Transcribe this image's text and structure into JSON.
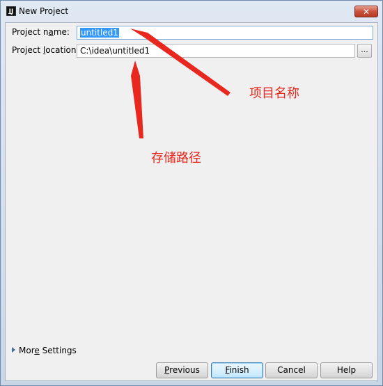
{
  "window": {
    "title": "New Project",
    "close_label": "✕"
  },
  "form": {
    "name_label": {
      "pre": "Project n",
      "accel": "a",
      "post": "me:"
    },
    "name_value": "untitled1",
    "location_label": {
      "pre": "Project ",
      "accel": "l",
      "post": "ocation:"
    },
    "location_value": "C:\\idea\\untitled1",
    "browse_label": "..."
  },
  "more_settings": {
    "pre": "Mor",
    "accel": "e",
    "post": " Settings"
  },
  "buttons": {
    "previous": {
      "accel": "P",
      "rest": "revious"
    },
    "finish": {
      "accel": "F",
      "rest": "inish"
    },
    "cancel": "Cancel",
    "help": "Help"
  },
  "annotations": {
    "project_name": "项目名称",
    "storage_path": "存储路径",
    "color": "#e8281e"
  }
}
